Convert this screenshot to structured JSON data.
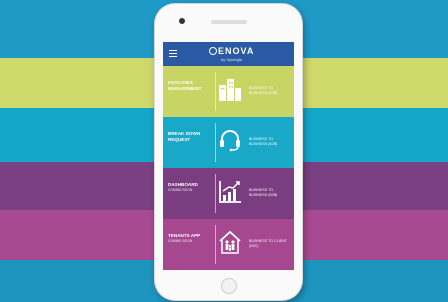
{
  "app": {
    "brand": "ENOVA",
    "brand_sub": "by Synergie"
  },
  "tiles": [
    {
      "title": "FACILITIES MANAGEMENT",
      "subtitle": "",
      "description": "BUSINESS TO BUSINESS (B2B)",
      "icon": "buildings-icon",
      "color": "#c8d464"
    },
    {
      "title": "BREAK DOWN REQUEST",
      "subtitle": "",
      "description": "BUSINESS TO BUSINESS (B2B)",
      "icon": "headset-icon",
      "color": "#19a8c8"
    },
    {
      "title": "DASHBOARD",
      "subtitle": "COMING SOON",
      "description": "BUSINESS TO BUSINESS (B2B)",
      "icon": "chart-icon",
      "color": "#7a3d80"
    },
    {
      "title": "TENANTS APP",
      "subtitle": "COMING SOON",
      "description": "BUSINESS TO CLIENT (B2C)",
      "icon": "family-house-icon",
      "color": "#a5488f"
    }
  ],
  "colors": {
    "appbar": "#2a5aa3"
  }
}
